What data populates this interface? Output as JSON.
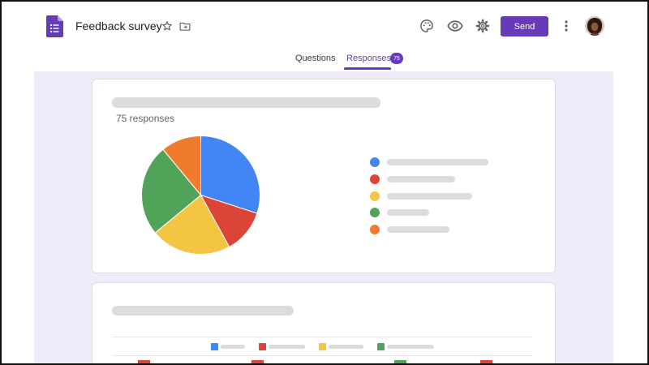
{
  "header": {
    "title": "Feedback survey",
    "send_label": "Send",
    "icons": [
      "forms-logo-icon",
      "star-icon",
      "folder-move-icon",
      "palette-icon",
      "eye-icon",
      "gear-icon",
      "more-vert-icon",
      "avatar"
    ]
  },
  "tabs": [
    {
      "label": "Questions",
      "active": false
    },
    {
      "label": "Responses",
      "active": true,
      "badge": "75"
    }
  ],
  "question1": {
    "responses_label": "75 responses",
    "chart_data": {
      "type": "pie",
      "title": "",
      "slices": [
        {
          "color": "#4285f4",
          "value": 30
        },
        {
          "color": "#db4437",
          "value": 12
        },
        {
          "color": "#f4c542",
          "value": 22
        },
        {
          "color": "#51a35a",
          "value": 25
        },
        {
          "color": "#f07b2d",
          "value": 11
        }
      ]
    },
    "legend_colors": [
      "#4285f4",
      "#db4437",
      "#f4c542",
      "#51a35a",
      "#f07b2d"
    ]
  },
  "question2": {
    "legend_colors": [
      "#4285f4",
      "#db4437",
      "#f4c542",
      "#51a35a"
    ]
  },
  "colors": {
    "accent": "#673ab7",
    "background": "#f0ebf8"
  }
}
